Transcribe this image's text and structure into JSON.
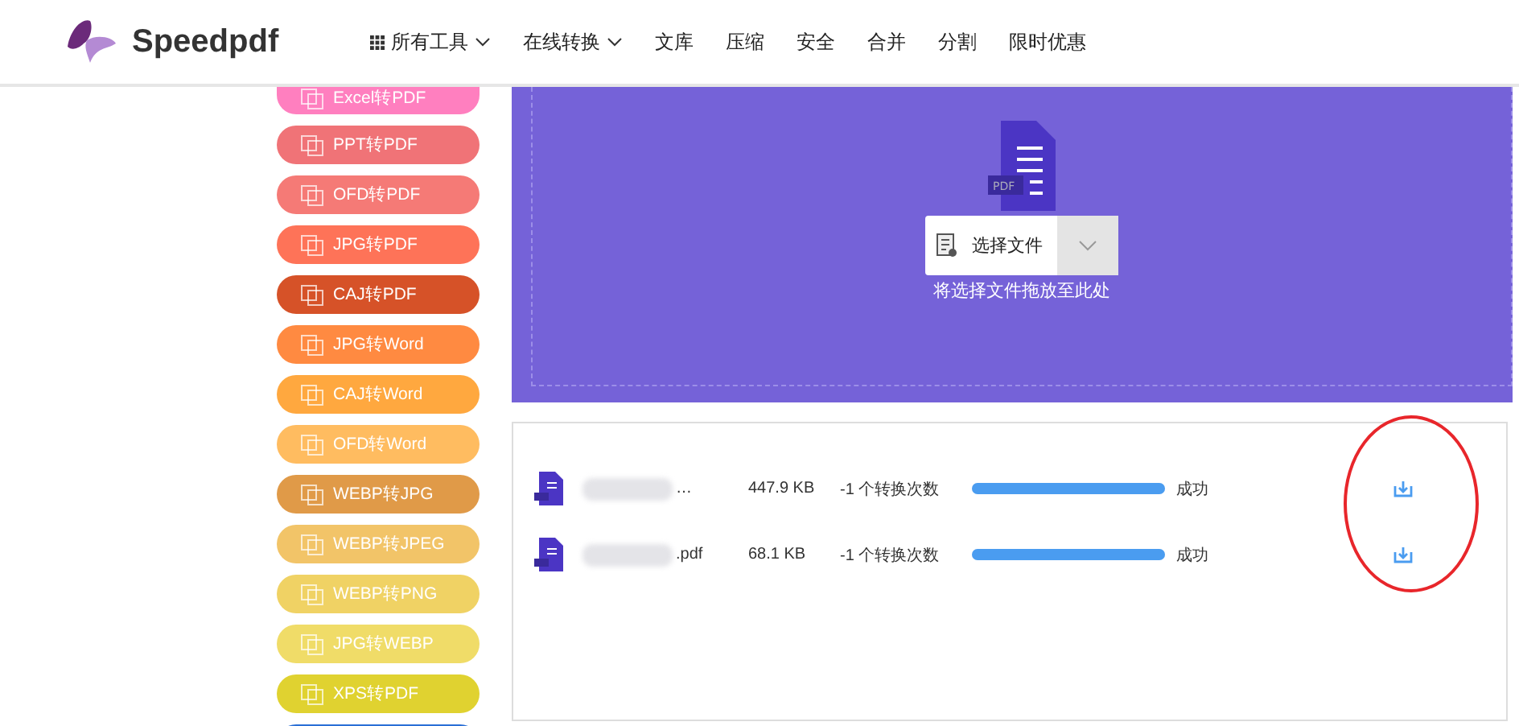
{
  "header": {
    "brand": "Speedpdf",
    "nav": [
      {
        "label": "所有工具",
        "grid_icon": true,
        "dropdown": true
      },
      {
        "label": "在线转换",
        "grid_icon": false,
        "dropdown": true
      },
      {
        "label": "文库",
        "grid_icon": false,
        "dropdown": false
      },
      {
        "label": "压缩",
        "grid_icon": false,
        "dropdown": false
      },
      {
        "label": "安全",
        "grid_icon": false,
        "dropdown": false
      },
      {
        "label": "合并",
        "grid_icon": false,
        "dropdown": false
      },
      {
        "label": "分割",
        "grid_icon": false,
        "dropdown": false
      },
      {
        "label": "限时优惠",
        "grid_icon": false,
        "dropdown": false
      }
    ]
  },
  "sidebar": {
    "items": [
      {
        "label": "Excel转PDF",
        "color": "#ff7fbf"
      },
      {
        "label": "PPT转PDF",
        "color": "#f07377"
      },
      {
        "label": "OFD转PDF",
        "color": "#f57a76"
      },
      {
        "label": "JPG转PDF",
        "color": "#fe7358"
      },
      {
        "label": "CAJ转PDF",
        "color": "#d65228"
      },
      {
        "label": "JPG转Word",
        "color": "#ff8a41"
      },
      {
        "label": "CAJ转Word",
        "color": "#ffa83f"
      },
      {
        "label": "OFD转Word",
        "color": "#ffbc60"
      },
      {
        "label": "WEBP转JPG",
        "color": "#e09a48"
      },
      {
        "label": "WEBP转JPEG",
        "color": "#f2c468"
      },
      {
        "label": "WEBP转PNG",
        "color": "#f0d264"
      },
      {
        "label": "JPG转WEBP",
        "color": "#f0dc68"
      },
      {
        "label": "XPS转PDF",
        "color": "#e0d230"
      },
      {
        "color": "#2a6fd6"
      }
    ]
  },
  "upload": {
    "icon_label": "PDF",
    "button": "选择文件",
    "hint": "将选择文件拖放至此处"
  },
  "files": [
    {
      "name": "…",
      "size": "447.9 KB",
      "count": "-1 个转换次数",
      "level": 1,
      "status": "成功"
    },
    {
      "name": ".pdf",
      "size": "68.1 KB",
      "count": "-1 个转换次数",
      "level": 1,
      "status": "成功"
    }
  ],
  "annotation": {
    "kind": "ellipse",
    "color": "#e8262b"
  }
}
